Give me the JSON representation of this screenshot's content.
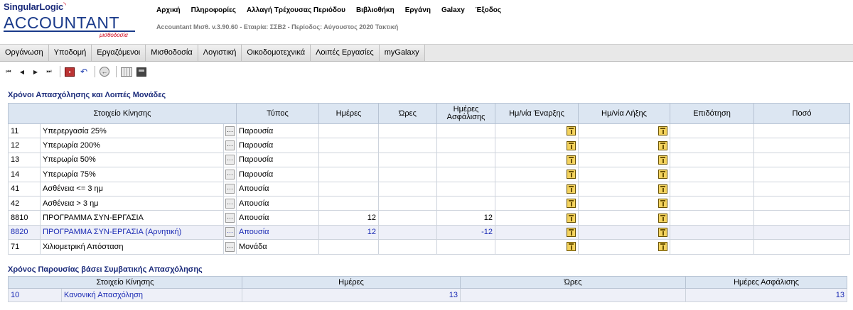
{
  "header": {
    "logo_top_1": "Singular",
    "logo_top_2": "Logic",
    "logo_main": "ACCOUNTANT",
    "logo_sub": "μισθοδοσία",
    "menu": [
      "Αρχική",
      "Πληροφορίες",
      "Αλλαγή Τρέχουσας Περιόδου",
      "Βιβλιοθήκη",
      "Εργάνη",
      "Galaxy",
      "Έξοδος"
    ],
    "subtitle": "Accountant Μισθ. v.3.90.60 - Εταιρία: ΣΣΒ2 - Περίοδος: Αύγουστος 2020 Τακτική"
  },
  "navbar": [
    "Οργάνωση",
    "Υποδομή",
    "Εργαζόμενοι",
    "Μισθοδοσία",
    "Λογιστική",
    "Οικοδομοτεχνικά",
    "Λοιπές Εργασίες",
    "myGalaxy"
  ],
  "toolbar": {
    "icons": [
      "first-record-icon",
      "previous-record-icon",
      "next-record-icon",
      "last-record-icon",
      "save-icon",
      "undo-icon",
      "back-icon",
      "grid-icon",
      "calculator-icon"
    ]
  },
  "section1": {
    "title": "Χρόνοι Απασχόλησης και Λοιπές Μονάδες",
    "headers": {
      "movement": "Στοιχείο Κίνησης",
      "type": "Τύπος",
      "days": "Ημέρες",
      "hours": "Ώρες",
      "insurance_days_1": "Ημέρες",
      "insurance_days_2": "Ασφάλισης",
      "start_date": "Ημ/νία Έναρξης",
      "end_date": "Ημ/νία Λήξης",
      "allowance": "Επιδότηση",
      "amount": "Ποσό"
    },
    "rows": [
      {
        "code": "11",
        "name": "Υπερεργασία 25%",
        "type": "Παρουσία",
        "days": "",
        "hours": "",
        "ins_days": ""
      },
      {
        "code": "12",
        "name": "Υπερωρία 200%",
        "type": "Παρουσία",
        "days": "",
        "hours": "",
        "ins_days": ""
      },
      {
        "code": "13",
        "name": "Υπερωρία 50%",
        "type": "Παρουσία",
        "days": "",
        "hours": "",
        "ins_days": ""
      },
      {
        "code": "14",
        "name": "Υπερωρία 75%",
        "type": "Παρουσία",
        "days": "",
        "hours": "",
        "ins_days": ""
      },
      {
        "code": "41",
        "name": "Ασθένεια <=  3 ημ",
        "type": "Απουσία",
        "days": "",
        "hours": "",
        "ins_days": ""
      },
      {
        "code": "42",
        "name": "Ασθένεια > 3 ημ",
        "type": "Απουσία",
        "days": "",
        "hours": "",
        "ins_days": ""
      },
      {
        "code": "8810",
        "name": "ΠΡΟΓΡΑΜΜΑ ΣΥΝ-ΕΡΓΑΣΙΑ",
        "type": "Απουσία",
        "days": "12",
        "hours": "",
        "ins_days": "12"
      },
      {
        "code": "8820",
        "name": "ΠΡΟΓΡΑΜΜΑ ΣΥΝ-ΕΡΓΑΣΙΑ (Αρνητική)",
        "type": "Απουσία",
        "days": "12",
        "hours": "",
        "ins_days": "-12"
      },
      {
        "code": "71",
        "name": "Χιλιομετρική Απόσταση",
        "type": "Μονάδα",
        "days": "",
        "hours": "",
        "ins_days": ""
      }
    ]
  },
  "section2": {
    "title": "Χρόνος Παρουσίας βάσει Συμβατικής Απασχόλησης",
    "headers": {
      "movement": "Στοιχείο Κίνησης",
      "days": "Ημέρες",
      "hours": "Ώρες",
      "insurance_days": "Ημέρες Ασφάλισης"
    },
    "rows": [
      {
        "code": "10",
        "name": "Κανονική Απασχόληση",
        "days": "13",
        "hours": "",
        "ins_days": "13"
      }
    ]
  },
  "colors": {
    "brand_blue": "#1a3a8a",
    "brand_red": "#d0021b",
    "header_bg": "#dce6f2",
    "highlight_text": "#1a2ab4"
  }
}
